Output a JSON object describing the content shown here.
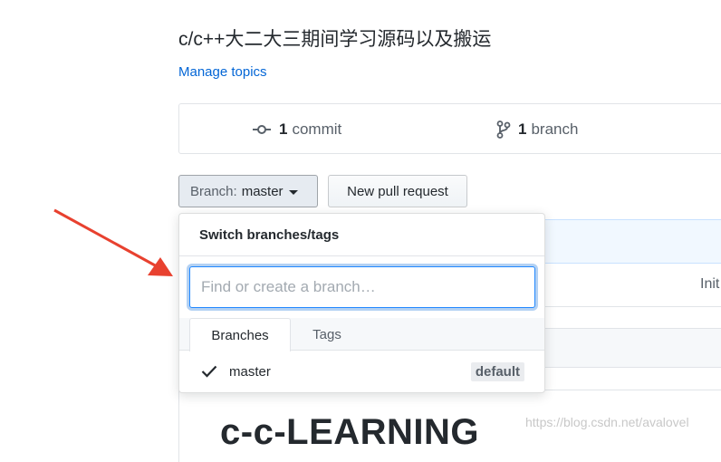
{
  "repo": {
    "description": "c/c++大二大三期间学习源码以及搬运",
    "manage_topics": "Manage topics"
  },
  "stats": {
    "commits_count": "1",
    "commits_label": "commit",
    "branches_count": "1",
    "branches_label": "branch"
  },
  "toolbar": {
    "branch_prefix": "Branch:",
    "branch_value": "master",
    "new_pr_label": "New pull request"
  },
  "dropdown": {
    "title": "Switch branches/tags",
    "filter_placeholder": "Find or create a branch…",
    "filter_value": "",
    "tabs": [
      {
        "label": "Branches",
        "selected": true
      },
      {
        "label": "Tags",
        "selected": false
      }
    ],
    "items": [
      {
        "name": "master",
        "badge": "default",
        "checked": true
      }
    ]
  },
  "commit_row": {
    "message_partial": "Init"
  },
  "readme": {
    "title_partial": "c-c-LEARNING"
  },
  "watermark": "https://blog.csdn.net/avalovel",
  "colors": {
    "link": "#0366d6",
    "annotation_arrow": "#e8412f",
    "focus_ring": "#2188ff",
    "highlight_bg": "#f1f8ff"
  },
  "icons": {
    "commit": "git-commit-icon",
    "branch": "git-branch-icon",
    "check": "check-icon",
    "caret": "caret-down-icon"
  }
}
